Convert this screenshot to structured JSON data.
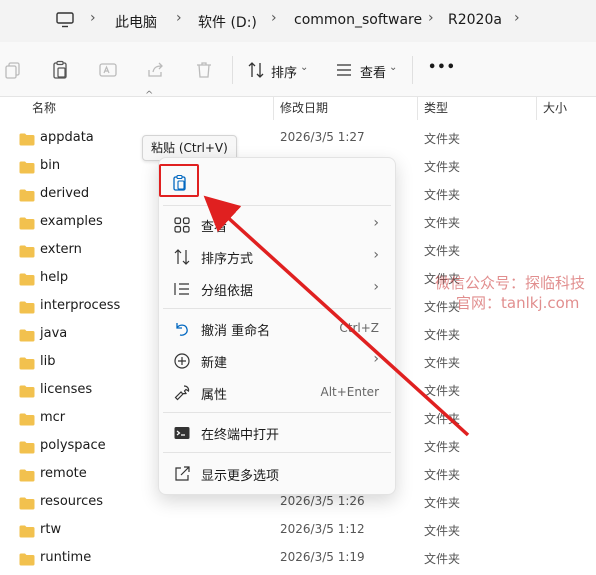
{
  "breadcrumb": {
    "items": [
      "此电脑",
      "软件 (D:)",
      "common_software",
      "R2020a"
    ]
  },
  "toolbar": {
    "sort_label": "排序",
    "view_label": "查看",
    "more_label": "•••"
  },
  "columns": {
    "name": "名称",
    "modified": "修改日期",
    "type": "类型",
    "size": "大小"
  },
  "files": [
    {
      "name": "appdata",
      "date": "2026/3/5 1:27",
      "type": "文件夹"
    },
    {
      "name": "bin",
      "date": "",
      "type": "文件夹"
    },
    {
      "name": "derived",
      "date": "",
      "type": "文件夹"
    },
    {
      "name": "examples",
      "date": "",
      "type": "文件夹"
    },
    {
      "name": "extern",
      "date": "",
      "type": "文件夹"
    },
    {
      "name": "help",
      "date": "",
      "type": "文件夹"
    },
    {
      "name": "interprocess",
      "date": "",
      "type": "文件夹"
    },
    {
      "name": "java",
      "date": "",
      "type": "文件夹"
    },
    {
      "name": "lib",
      "date": "",
      "type": "文件夹"
    },
    {
      "name": "licenses",
      "date": "",
      "type": "文件夹"
    },
    {
      "name": "mcr",
      "date": "",
      "type": "文件夹"
    },
    {
      "name": "polyspace",
      "date": "",
      "type": "文件夹"
    },
    {
      "name": "remote",
      "date": "",
      "type": "文件夹"
    },
    {
      "name": "resources",
      "date": "2026/3/5 1:26",
      "type": "文件夹"
    },
    {
      "name": "rtw",
      "date": "2026/3/5 1:12",
      "type": "文件夹"
    },
    {
      "name": "runtime",
      "date": "2026/3/5 1:19",
      "type": "文件夹"
    }
  ],
  "tooltip": "粘贴 (Ctrl+V)",
  "context_menu": {
    "view": "查看",
    "sort": "排序方式",
    "group": "分组依据",
    "undo": "撤消 重命名",
    "undo_key": "Ctrl+Z",
    "new": "新建",
    "properties": "属性",
    "properties_key": "Alt+Enter",
    "terminal": "在终端中打开",
    "more_options": "显示更多选项"
  },
  "watermark": {
    "line1": "微信公众号：探临科技",
    "line2": "官网：tanlkj.com"
  },
  "colors": {
    "accent": "#0067c0",
    "highlight": "#e02020",
    "folder": "#f2c14e"
  }
}
